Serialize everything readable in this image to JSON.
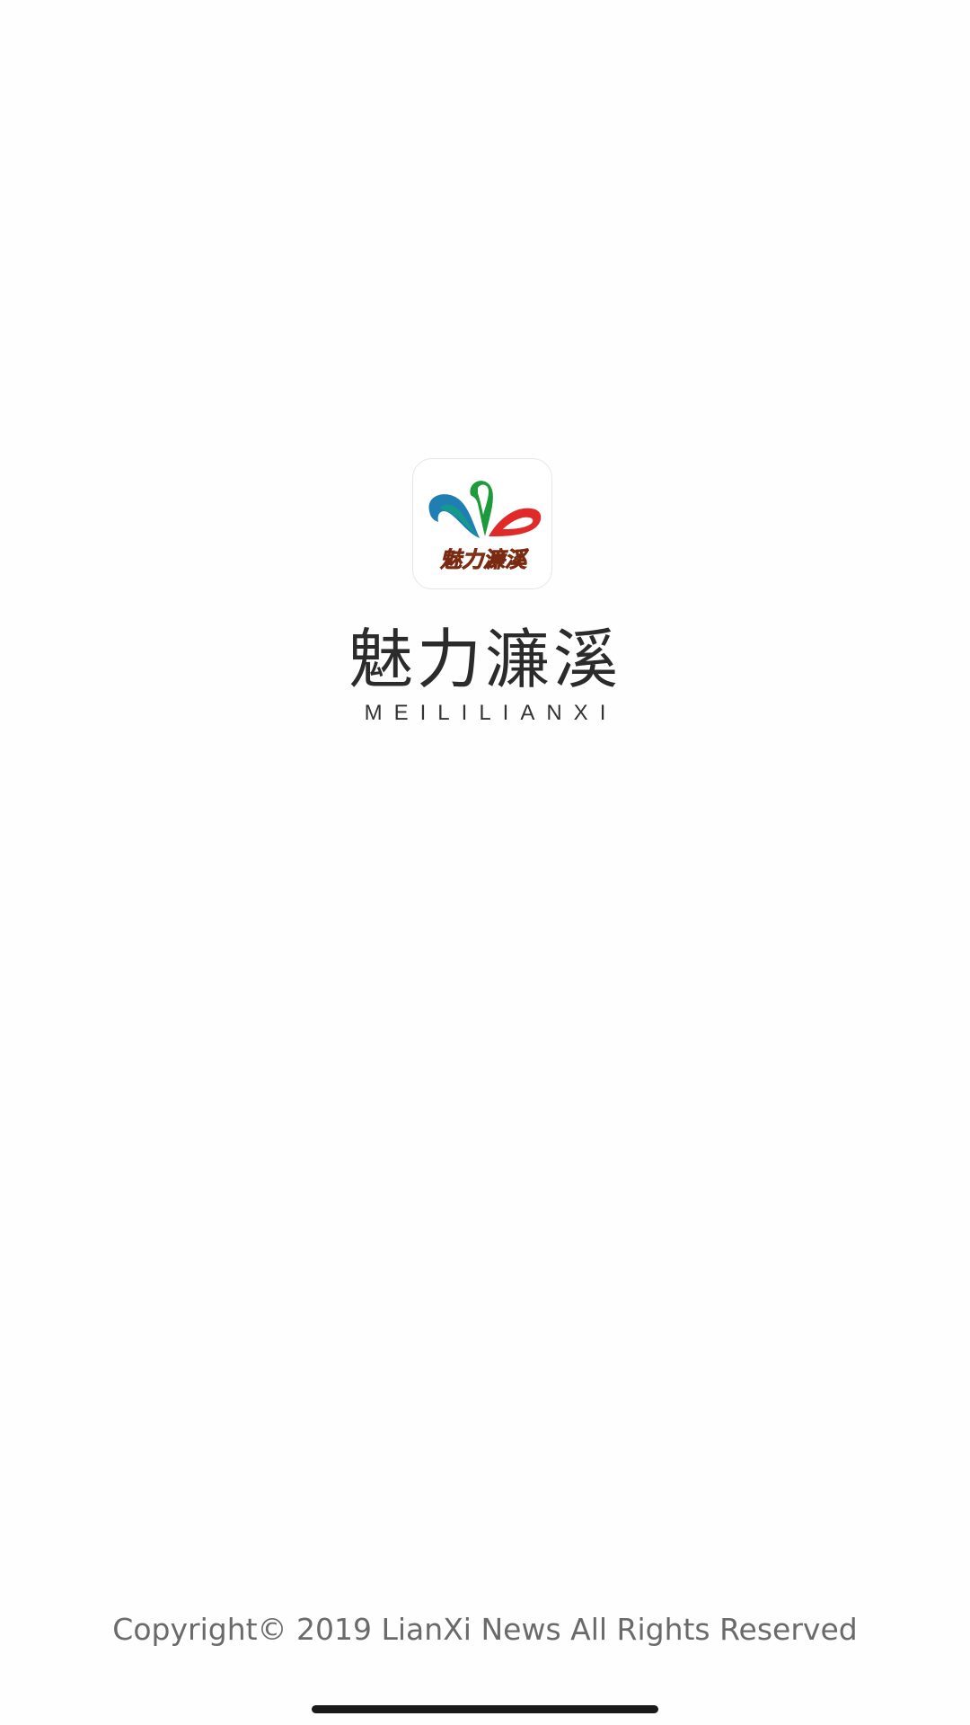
{
  "splash": {
    "logo": {
      "icon_name": "meililianxi-logo-icon",
      "logo_text": "魅力濂溪",
      "colors": {
        "blue": "#1f7fb3",
        "teal": "#149a8c",
        "green": "#1d9a3c",
        "red": "#e02a2a",
        "gold": "#c8860f"
      }
    },
    "title": "魅力濂溪",
    "subtitle": "MEILILIANXI"
  },
  "footer": {
    "copyright": "Copyright© 2019 LianXi News All Rights Reserved"
  },
  "system": {
    "home_indicator_color": "#1a1a1a"
  }
}
